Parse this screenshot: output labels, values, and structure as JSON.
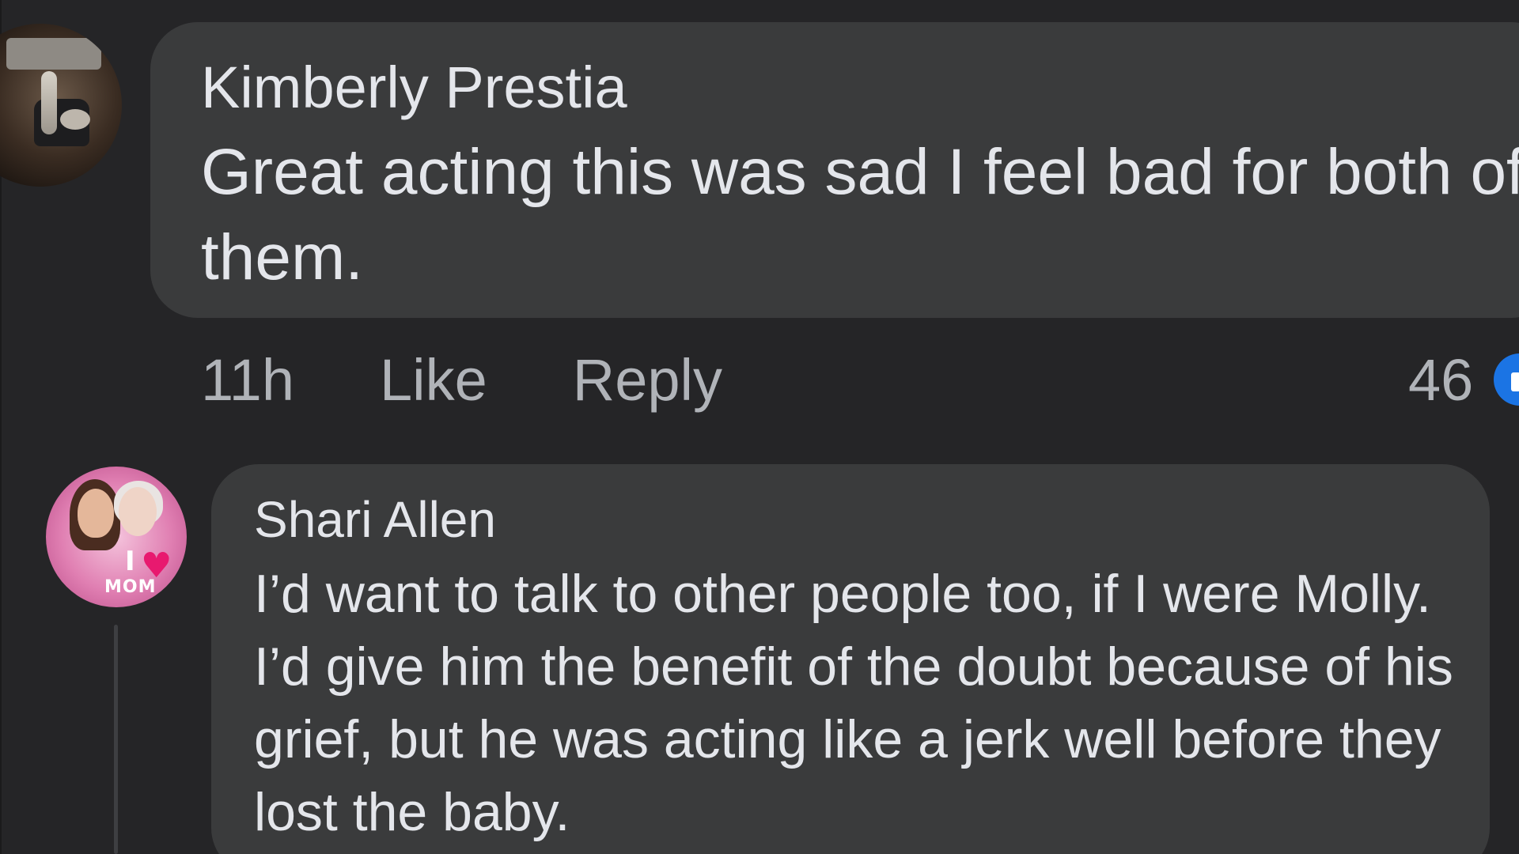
{
  "comments": [
    {
      "author": "Kimberly Prestia",
      "text": "Great acting this was sad I feel bad for both of them.",
      "time": "11h",
      "like_label": "Like",
      "reply_label": "Reply",
      "reaction_count": "46",
      "reaction_icon": "like-reaction-icon"
    },
    {
      "author": "Shari Allen",
      "text": "I’d want to talk to other people too, if I were Molly. I’d give him the benefit of the doubt because of his grief, but he was acting like a jerk well before they lost the baby."
    }
  ],
  "avatar_2_badge": {
    "heart": "♥",
    "letter": "I",
    "word": "MOM"
  },
  "colors": {
    "background": "#252527",
    "bubble": "#3a3b3c",
    "primary_text": "#e4e6eb",
    "secondary_text": "#b0b3b8",
    "reaction_blue": "#1b74e4"
  }
}
